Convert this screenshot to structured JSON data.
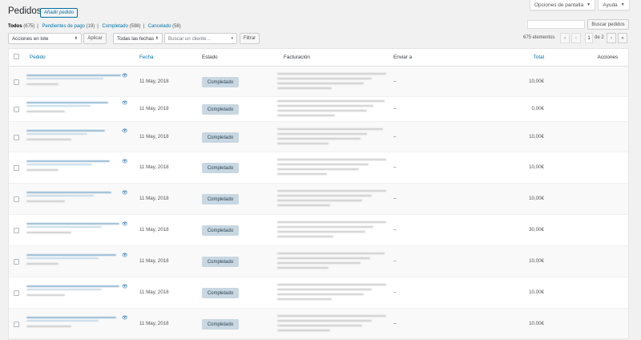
{
  "topbar": {
    "screen_options": "Opciones de pantalla",
    "help": "Ayuda"
  },
  "page_title": "Pedidos",
  "add_order": "Añadir pedido",
  "filters": {
    "all": "Todos",
    "all_count": "(675)",
    "pending": "Pendientes de pago",
    "pending_count": "(19)",
    "completed": "Completado",
    "completed_count": "(598)",
    "cancelled": "Cancelado",
    "cancelled_count": "(58)"
  },
  "search": {
    "button": "Buscar pedidos",
    "value": ""
  },
  "bulk": {
    "select": "Acciones en lote",
    "apply": "Aplicar",
    "dates": "Todas las fechas",
    "customer_placeholder": "Buscar un cliente…",
    "filter": "Filtrar"
  },
  "pagination": {
    "count": "675 elementos",
    "first": "«",
    "prev": "‹",
    "current": "1",
    "of": "de 2",
    "next": "›",
    "last": "»"
  },
  "columns": {
    "order": "Pedido",
    "date": "Fecha",
    "status": "Estado",
    "billing": "Facturación",
    "ship_to": "Enviar a",
    "total": "Total",
    "actions": "Acciones"
  },
  "rows": [
    {
      "date": "11 May, 2018",
      "status": "Completado",
      "ship_to": "–",
      "total": "10,00€"
    },
    {
      "date": "11 May, 2018",
      "status": "Completado",
      "ship_to": "–",
      "total": "0,00€"
    },
    {
      "date": "11 May, 2018",
      "status": "Completado",
      "ship_to": "–",
      "total": "10,00€"
    },
    {
      "date": "11 May, 2018",
      "status": "Completado",
      "ship_to": "–",
      "total": "10,00€"
    },
    {
      "date": "11 May, 2018",
      "status": "Completado",
      "ship_to": "–",
      "total": "10,00€"
    },
    {
      "date": "11 May, 2018",
      "status": "Completado",
      "ship_to": "–",
      "total": "30,00€"
    },
    {
      "date": "11 May, 2018",
      "status": "Completado",
      "ship_to": "–",
      "total": "10,00€"
    },
    {
      "date": "11 May, 2018",
      "status": "Completado",
      "ship_to": "–",
      "total": "10,00€"
    },
    {
      "date": "11 May, 2018",
      "status": "Completado",
      "ship_to": "–",
      "total": "10,00€"
    }
  ],
  "icons": {
    "preview": "eye-icon",
    "dropdown": "caret-down-icon"
  }
}
